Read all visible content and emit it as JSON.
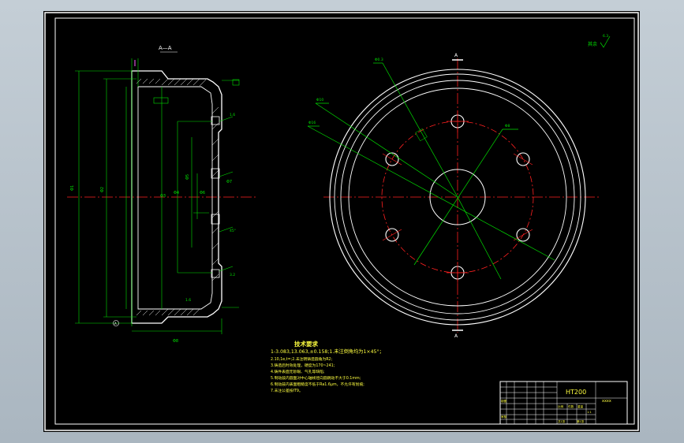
{
  "drawing": {
    "section_label": "A—A",
    "view_mark_top": "A",
    "view_mark_bottom": "A",
    "roughness_note": "其余",
    "roughness_value": "6.3",
    "leader_labels": [
      "Φ0.3",
      "Φ10",
      "Φ16"
    ],
    "side_dim_labels": [
      "Φ1",
      "Φ2",
      "Φ3",
      "Φ4",
      "Φ5",
      "Φ6",
      "Φ7",
      "Φ8"
    ],
    "chamfer_labels": [
      "1.6",
      "45°",
      "3.2",
      "1.6"
    ],
    "datum_label": "A",
    "bolt_circle_label": "Φ8"
  },
  "tech_req": {
    "title": "技术要求",
    "lines": [
      "1-3.083,13.063,±0.158;1.未注倒角均为1×45°；",
      "2.10,1e,t=;2.未注明铸造圆角为R2;",
      "3.铸造后时效处理，硬度为170~241;",
      "4.铸件表面无砂眼、气孔等缺陷;",
      "5.制动鼓内圆面对中心轴线径向圆跳动不大于0.1mm;",
      "6.制动鼓内表面粗糙度不低于Ra1.6μm，不允许有划痕;",
      "7.未注公差按IT9。"
    ]
  },
  "title_block": {
    "material": "HT200",
    "school": "xxxx",
    "labels": [
      "制图",
      "审核",
      "比例",
      "1:1",
      "件数",
      "重量",
      "共1张",
      "第1张"
    ]
  },
  "colors": {
    "outline": "#ffffff",
    "dimension": "#00e000",
    "centerline": "#ff2020",
    "text_yellow": "#ffff40",
    "highlight": "#ff60ff"
  }
}
